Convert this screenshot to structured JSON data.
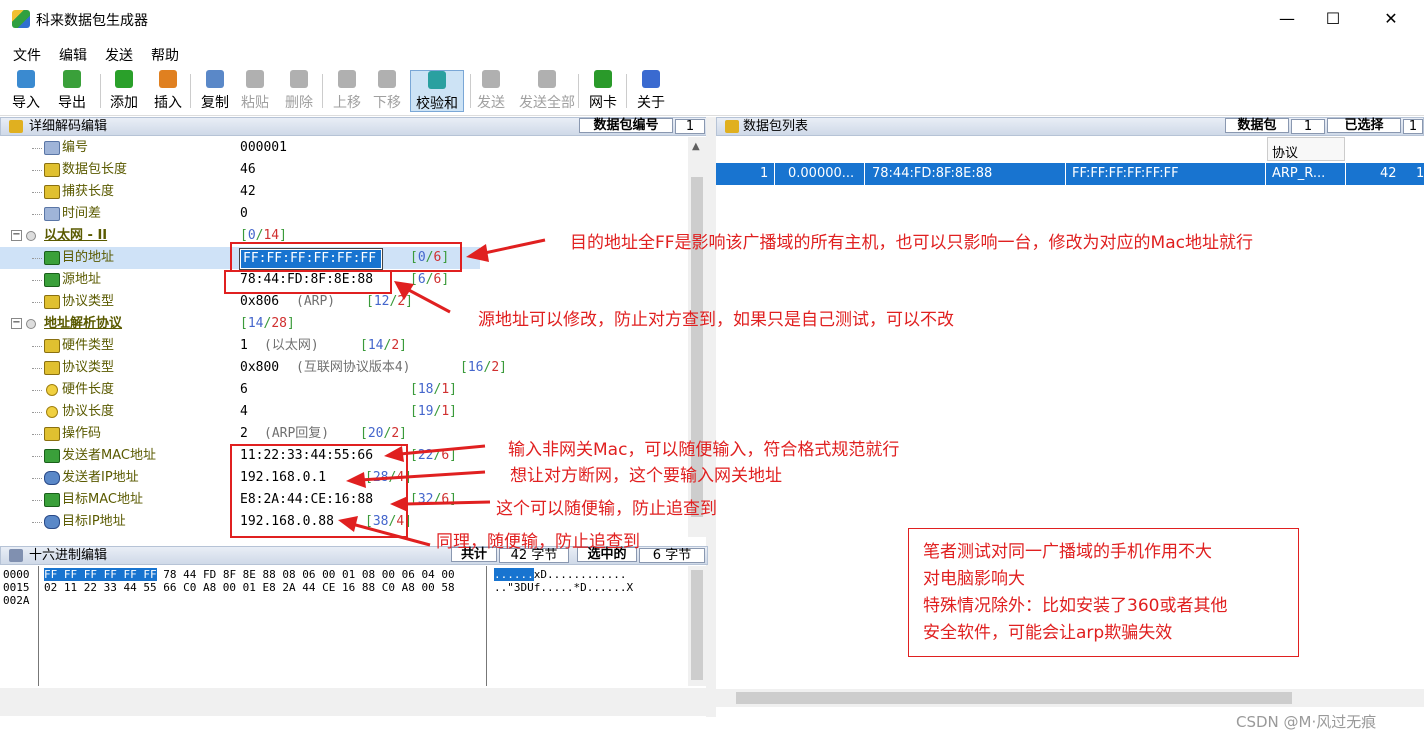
{
  "window": {
    "title": "科来数据包生成器",
    "minimize": "—",
    "maximize": "☐",
    "close": "✕"
  },
  "menu": [
    "文件",
    "编辑",
    "发送",
    "帮助"
  ],
  "toolbar": [
    {
      "label": "导入",
      "icon": "import-icon",
      "color": "#3a8ad0",
      "enabled": true
    },
    {
      "label": "导出",
      "icon": "export-icon",
      "color": "#3aa03a",
      "enabled": true
    },
    {
      "label": "添加",
      "icon": "add-icon",
      "color": "#2aa02a",
      "enabled": true
    },
    {
      "label": "插入",
      "icon": "insert-icon",
      "color": "#e08020",
      "enabled": true
    },
    {
      "label": "复制",
      "icon": "copy-icon",
      "color": "#5a88c8",
      "enabled": true
    },
    {
      "label": "粘贴",
      "icon": "paste-icon",
      "color": "#b0b0b0",
      "enabled": false
    },
    {
      "label": "删除",
      "icon": "delete-icon",
      "color": "#b0b0b0",
      "enabled": false
    },
    {
      "label": "上移",
      "icon": "move-up-icon",
      "color": "#b0b0b0",
      "enabled": false
    },
    {
      "label": "下移",
      "icon": "move-down-icon",
      "color": "#b0b0b0",
      "enabled": false
    },
    {
      "label": "校验和",
      "icon": "checksum-icon",
      "color": "#2aa0a0",
      "enabled": true
    },
    {
      "label": "发送",
      "icon": "send-icon",
      "color": "#b0b0b0",
      "enabled": false
    },
    {
      "label": "发送全部",
      "icon": "send-all-icon",
      "color": "#b0b0b0",
      "enabled": false
    },
    {
      "label": "网卡",
      "icon": "nic-icon",
      "color": "#2a9a2a",
      "enabled": true
    },
    {
      "label": "关于",
      "icon": "about-icon",
      "color": "#3a6ad0",
      "enabled": true
    }
  ],
  "decode_pane": {
    "title": "详细解码编辑",
    "packet_no_label": "数据包编号",
    "packet_no": "1",
    "rows": [
      {
        "label": "编号",
        "value": "000001",
        "icon": "doc"
      },
      {
        "label": "数据包长度",
        "value": "46",
        "icon": "key"
      },
      {
        "label": "捕获长度",
        "value": "42",
        "icon": "key"
      },
      {
        "label": "时间差",
        "value": "0",
        "icon": "doc"
      },
      {
        "label": "以太网 - II",
        "value": "",
        "range_a": "0",
        "range_b": "14",
        "section": true
      },
      {
        "label": "目的地址",
        "value": "FF:FF:FF:FF:FF:FF",
        "range_a": "0",
        "range_b": "6",
        "icon": "ether",
        "selected": true
      },
      {
        "label": "源地址",
        "value": "78:44:FD:8F:8E:88",
        "range_a": "6",
        "range_b": "6",
        "icon": "ether"
      },
      {
        "label": "协议类型",
        "value": "0x806",
        "note": "(ARP)",
        "range_a": "12",
        "range_b": "2",
        "icon": "key"
      },
      {
        "label": "地址解析协议",
        "value": "",
        "range_a": "14",
        "range_b": "28",
        "section": true
      },
      {
        "label": "硬件类型",
        "value": "1",
        "note": "(以太网)",
        "range_a": "14",
        "range_b": "2",
        "icon": "key"
      },
      {
        "label": "协议类型",
        "value": "0x800",
        "note": "(互联网协议版本4)",
        "range_a": "16",
        "range_b": "2",
        "icon": "key"
      },
      {
        "label": "硬件长度",
        "value": "6",
        "range_a": "18",
        "range_b": "1",
        "icon": "circ"
      },
      {
        "label": "协议长度",
        "value": "4",
        "range_a": "19",
        "range_b": "1",
        "icon": "circ"
      },
      {
        "label": "操作码",
        "value": "2",
        "note": "(ARP回复)",
        "range_a": "20",
        "range_b": "2",
        "icon": "key"
      },
      {
        "label": "发送者MAC地址",
        "value": "11:22:33:44:55:66",
        "range_a": "22",
        "range_b": "6",
        "icon": "ether"
      },
      {
        "label": "发送者IP地址",
        "value": "192.168.0.1",
        "range_a": "28",
        "range_b": "4",
        "icon": "ip"
      },
      {
        "label": "目标MAC地址",
        "value": "E8:2A:44:CE:16:88",
        "range_a": "32",
        "range_b": "6",
        "icon": "ether"
      },
      {
        "label": "目标IP地址",
        "value": "192.168.0.88",
        "range_a": "38",
        "range_b": "4",
        "icon": "ip"
      }
    ]
  },
  "hex_pane": {
    "title": "十六进制编辑",
    "total_label": "共计",
    "total": "42 字节",
    "selected_label": "选中的",
    "selected": "6 字节",
    "offsets": [
      "0000",
      "0015",
      "002A"
    ],
    "hex_sel": "FF FF FF FF FF FF",
    "hex_line1_rest": " 78 44 FD 8F 8E 88 08 06 00 01 08 00 06 04 00",
    "hex_line2": "02 11 22 33 44 55 66 C0 A8 00 01 E8 2A 44 CE 16 88 C0 A8 00 58",
    "ascii_sel": "......",
    "ascii_line1_rest": "xD............",
    "ascii_line2": "..\"3DUf.....*D......X"
  },
  "packet_list": {
    "title": "数据包列表",
    "count_label": "数据包",
    "count": "1",
    "selected_label": "已选择",
    "selected": "1",
    "column_protocol": "协议",
    "row": {
      "no": "1",
      "time": "0.00000...",
      "src": "78:44:FD:8F:8E:88",
      "dst": "FF:FF:FF:FF:FF:FF",
      "proto": "ARP_R...",
      "len": "42",
      "extra": "1"
    }
  },
  "annotations": {
    "a1": "目的地址全FF是影响该广播域的所有主机，也可以只影响一台，修改为对应的Mac地址就行",
    "a2": "源地址可以修改，防止对方查到，如果只是自己测试，可以不改",
    "a3": "输入非网关Mac，可以随便输入，符合格式规范就行",
    "a4": "想让对方断网，这个要输入网关地址",
    "a5": "这个可以随便输，防止追查到",
    "a6": "同理，随便输，防止追查到",
    "note": [
      "笔者测试对同一广播域的手机作用不大",
      "对电脑影响大",
      "特殊情况除外：比如安装了360或者其他",
      "安全软件，可能会让arp欺骗失效"
    ]
  },
  "watermark": "CSDN @M·风过无痕",
  "colors": {
    "selection": "#1874d0",
    "annotation": "#e02020",
    "tree_label": "#5a5a00",
    "section": "#1a3a9a"
  }
}
